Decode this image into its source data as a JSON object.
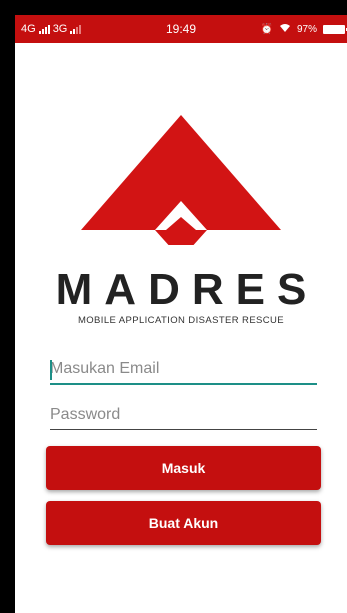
{
  "status_bar": {
    "network1": "4G",
    "network2": "3G",
    "time": "19:49",
    "battery": "97%"
  },
  "logo": {
    "brand": "MADRES",
    "tagline": "MOBILE APPLICATION DISASTER RESCUE"
  },
  "form": {
    "email_placeholder": "Masukan Email",
    "password_placeholder": "Password",
    "login_label": "Masuk",
    "register_label": "Buat Akun"
  },
  "colors": {
    "primary": "#c40f0f",
    "accent": "#1d8f87"
  }
}
